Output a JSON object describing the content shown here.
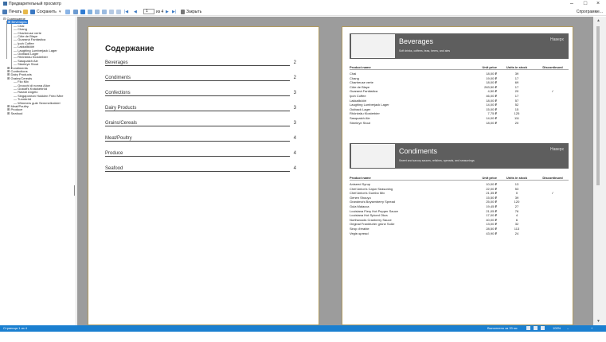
{
  "window": {
    "title": "Предварительный просмотр",
    "minimize": "–",
    "maximize": "□",
    "close": "×"
  },
  "toolbar": {
    "print_label": "Печать",
    "save_label": "Сохранить",
    "page_value": "1",
    "page_total": "из 4",
    "close_label": "Закрыть",
    "right_label": "Спрограмме..."
  },
  "tree": {
    "root": "Содержание",
    "items": [
      {
        "label": "Beverages",
        "level": 1,
        "selected": true
      },
      {
        "label": "Chai",
        "level": 2
      },
      {
        "label": "Chang",
        "level": 2
      },
      {
        "label": "Chartreuse verte",
        "level": 2
      },
      {
        "label": "Côte de Blaye",
        "level": 2
      },
      {
        "label": "Guaraná Fantástica",
        "level": 2
      },
      {
        "label": "Ipoh Coffee",
        "level": 2
      },
      {
        "label": "Lakkalikööri",
        "level": 2
      },
      {
        "label": "Laughing Lumberjack Lager",
        "level": 2
      },
      {
        "label": "Outback Lager",
        "level": 2
      },
      {
        "label": "Rhönbräu Klosterbier",
        "level": 2
      },
      {
        "label": "Sasquatch Ale",
        "level": 2
      },
      {
        "label": "Steeleye Stout",
        "level": 2
      },
      {
        "label": "Condiments",
        "level": 1
      },
      {
        "label": "Confections",
        "level": 1
      },
      {
        "label": "Dairy Products",
        "level": 1
      },
      {
        "label": "Grains/Cereals",
        "level": 1
      },
      {
        "label": "Filo Mix",
        "level": 2
      },
      {
        "label": "Gnocchi di nonna Alice",
        "level": 2
      },
      {
        "label": "Gustaf's Knäckebröd",
        "level": 2
      },
      {
        "label": "Ravioli Angelo",
        "level": 2
      },
      {
        "label": "Singaporean Hokkien Fried Mee",
        "level": 2
      },
      {
        "label": "Tunnbröd",
        "level": 2
      },
      {
        "label": "Wimmers gute Semmelknödel",
        "level": 2
      },
      {
        "label": "Meat/Poultry",
        "level": 1
      },
      {
        "label": "Produce",
        "level": 1
      },
      {
        "label": "Seafood",
        "level": 1
      }
    ]
  },
  "toc": {
    "title": "Содержание",
    "entries": [
      {
        "name": "Beverages",
        "page": "2"
      },
      {
        "name": "Condiments",
        "page": "2"
      },
      {
        "name": "Confections",
        "page": "3"
      },
      {
        "name": "Dairy Products",
        "page": "3"
      },
      {
        "name": "Grains/Cereals",
        "page": "3"
      },
      {
        "name": "Meat/Poultry",
        "page": "4"
      },
      {
        "name": "Produce",
        "page": "4"
      },
      {
        "name": "Seafood",
        "page": "4"
      }
    ]
  },
  "report": {
    "headers": {
      "name": "Product name",
      "price": "Unit price",
      "units": "Units in stock",
      "disc": "Discontinued"
    },
    "categories": [
      {
        "name": "Beverages",
        "description": "Soft drinks, coffees, teas, beers, and ales",
        "top_link": "Наверх",
        "products": [
          {
            "name": "Chai",
            "price": "18,00 ₽",
            "units": "39",
            "disc": ""
          },
          {
            "name": "Chang",
            "price": "19,00 ₽",
            "units": "17",
            "disc": ""
          },
          {
            "name": "Chartreuse verte",
            "price": "18,00 ₽",
            "units": "69",
            "disc": ""
          },
          {
            "name": "Côte de Blaye",
            "price": "263,50 ₽",
            "units": "17",
            "disc": ""
          },
          {
            "name": "Guaraná Fantástica",
            "price": "4,50 ₽",
            "units": "20",
            "disc": "✓"
          },
          {
            "name": "Ipoh Coffee",
            "price": "46,00 ₽",
            "units": "17",
            "disc": ""
          },
          {
            "name": "Lakkalikööri",
            "price": "18,00 ₽",
            "units": "57",
            "disc": ""
          },
          {
            "name": "Laughing Lumberjack Lager",
            "price": "14,00 ₽",
            "units": "52",
            "disc": ""
          },
          {
            "name": "Outback Lager",
            "price": "15,00 ₽",
            "units": "15",
            "disc": ""
          },
          {
            "name": "Rhönbräu Klosterbier",
            "price": "7,75 ₽",
            "units": "125",
            "disc": ""
          },
          {
            "name": "Sasquatch Ale",
            "price": "14,00 ₽",
            "units": "111",
            "disc": ""
          },
          {
            "name": "Steeleye Stout",
            "price": "18,00 ₽",
            "units": "20",
            "disc": ""
          }
        ]
      },
      {
        "name": "Condiments",
        "description": "Sweet and savory sauces, relishes, spreads, and seasonings",
        "top_link": "Наверх",
        "products": [
          {
            "name": "Aniseed Syrup",
            "price": "10,00 ₽",
            "units": "13",
            "disc": ""
          },
          {
            "name": "Chef Anton's Cajun Seasoning",
            "price": "22,00 ₽",
            "units": "53",
            "disc": ""
          },
          {
            "name": "Chef Anton's Gumbo Mix",
            "price": "21,35 ₽",
            "units": "0",
            "disc": "✓"
          },
          {
            "name": "Genen Shouyu",
            "price": "15,50 ₽",
            "units": "39",
            "disc": ""
          },
          {
            "name": "Grandma's Boysenberry Spread",
            "price": "25,00 ₽",
            "units": "120",
            "disc": ""
          },
          {
            "name": "Gula Malacca",
            "price": "19,45 ₽",
            "units": "27",
            "disc": ""
          },
          {
            "name": "Louisiana Fiery Hot Pepper Sauce",
            "price": "21,05 ₽",
            "units": "76",
            "disc": ""
          },
          {
            "name": "Louisiana Hot Spiced Okra",
            "price": "17,00 ₽",
            "units": "4",
            "disc": ""
          },
          {
            "name": "Northwoods Cranberry Sauce",
            "price": "40,00 ₽",
            "units": "6",
            "disc": ""
          },
          {
            "name": "Original Frankfurter grüne Soße",
            "price": "13,00 ₽",
            "units": "32",
            "disc": ""
          },
          {
            "name": "Sirop d'érable",
            "price": "28,50 ₽",
            "units": "113",
            "disc": ""
          },
          {
            "name": "Vegie-spread",
            "price": "43,90 ₽",
            "units": "24",
            "disc": ""
          }
        ]
      }
    ]
  },
  "status": {
    "page_info": "Страница 1 из 4",
    "time": "Выполнено за 33 мс",
    "zoom": "100%"
  }
}
